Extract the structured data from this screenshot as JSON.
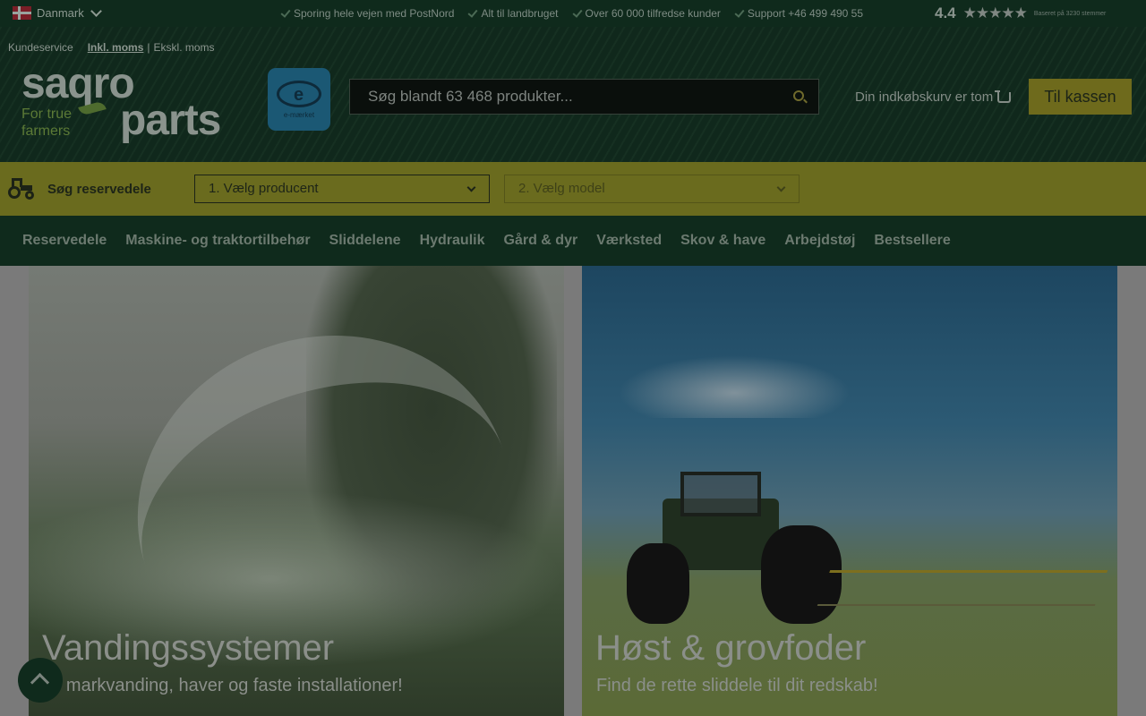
{
  "topbar": {
    "country": "Danmark",
    "usps": [
      "Sporing hele vejen med PostNord",
      "Alt til landbruget",
      "Over 60 000 tilfredse kunder",
      "Support +46 499 490 55"
    ],
    "rating": "4.4",
    "stars": "★★★★★",
    "rating_note": "Baseret på 3230 stemmer"
  },
  "header": {
    "links": {
      "customer_service": "Kundeservice",
      "incl_vat": "Inkl. moms",
      "separator": "|",
      "excl_vat": "Ekskl. moms"
    },
    "logo": {
      "line1": "saqro",
      "line2": "parts",
      "tagline1": "For true",
      "tagline2": "farmers"
    },
    "emark_label": "e-mærket",
    "emark_letter": "e",
    "search_placeholder": "Søg blandt 63 468 produkter...",
    "cart_text": "Din indkøbskurv er tom",
    "checkout_label": "Til kassen"
  },
  "finder": {
    "label": "Søg reservedele",
    "select_manufacturer": "1. Vælg producent",
    "select_model": "2. Vælg model"
  },
  "nav": [
    "Reservedele",
    "Maskine- og traktortilbehør",
    "Sliddelene",
    "Hydraulik",
    "Gård & dyr",
    "Værksted",
    "Skov & have",
    "Arbejdstøj",
    "Bestsellere"
  ],
  "cards": [
    {
      "title": "Vandingssystemer",
      "subtitle": "Til markvanding, haver og faste installationer!"
    },
    {
      "title": "Høst & grovfoder",
      "subtitle": "Find de rette sliddele til dit redskab!"
    }
  ],
  "colors": {
    "dark_green": "#0f2a1c",
    "yellow": "#6a6b1e",
    "overlay_note": "page shown under dark modal overlay"
  }
}
